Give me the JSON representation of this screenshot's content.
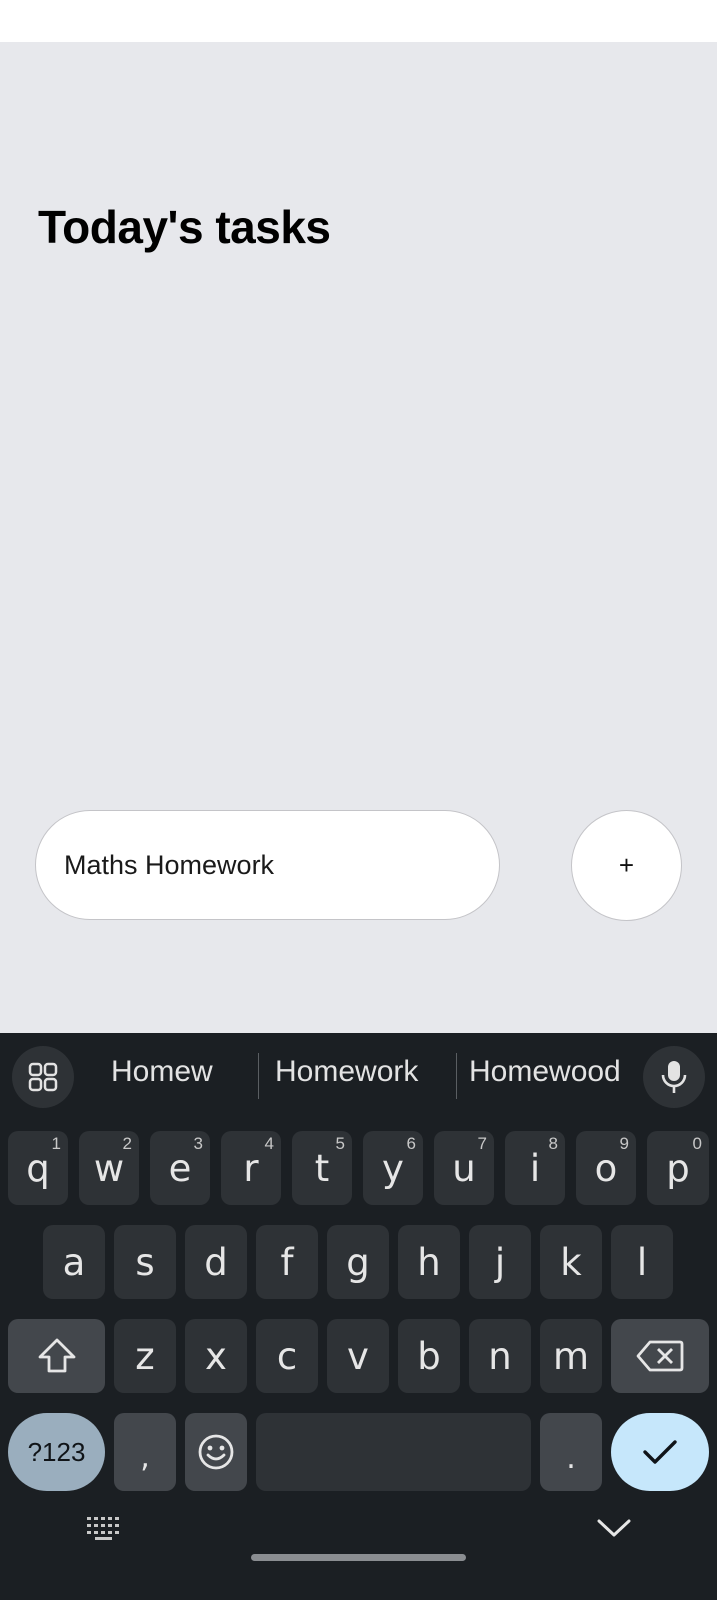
{
  "app": {
    "title": "Today's tasks",
    "task_input_value": "Maths Homework",
    "add_button_label": "+"
  },
  "keyboard": {
    "suggestions": [
      "Homew",
      "Homework",
      "Homewood"
    ],
    "row1": [
      {
        "key": "q",
        "hint": "1"
      },
      {
        "key": "w",
        "hint": "2"
      },
      {
        "key": "e",
        "hint": "3"
      },
      {
        "key": "r",
        "hint": "4"
      },
      {
        "key": "t",
        "hint": "5"
      },
      {
        "key": "y",
        "hint": "6"
      },
      {
        "key": "u",
        "hint": "7"
      },
      {
        "key": "i",
        "hint": "8"
      },
      {
        "key": "o",
        "hint": "9"
      },
      {
        "key": "p",
        "hint": "0"
      }
    ],
    "row2": [
      "a",
      "s",
      "d",
      "f",
      "g",
      "h",
      "j",
      "k",
      "l"
    ],
    "row3": [
      "z",
      "x",
      "c",
      "v",
      "b",
      "n",
      "m"
    ],
    "symbols_label": "?123",
    "comma_label": ",",
    "period_label": ".",
    "icons": {
      "apps": "apps-grid-icon",
      "mic": "microphone-icon",
      "shift": "shift-icon",
      "backspace": "backspace-icon",
      "emoji": "emoji-icon",
      "enter": "checkmark-icon",
      "keyboard_switch": "keyboard-icon",
      "hide_keyboard": "chevron-down-icon"
    }
  },
  "colors": {
    "app_background": "#e7e8ec",
    "keyboard_background": "#1b1f23",
    "key": "#2e3236",
    "enter_key": "#c6e7fb",
    "symbols_key": "#9aaebe"
  }
}
